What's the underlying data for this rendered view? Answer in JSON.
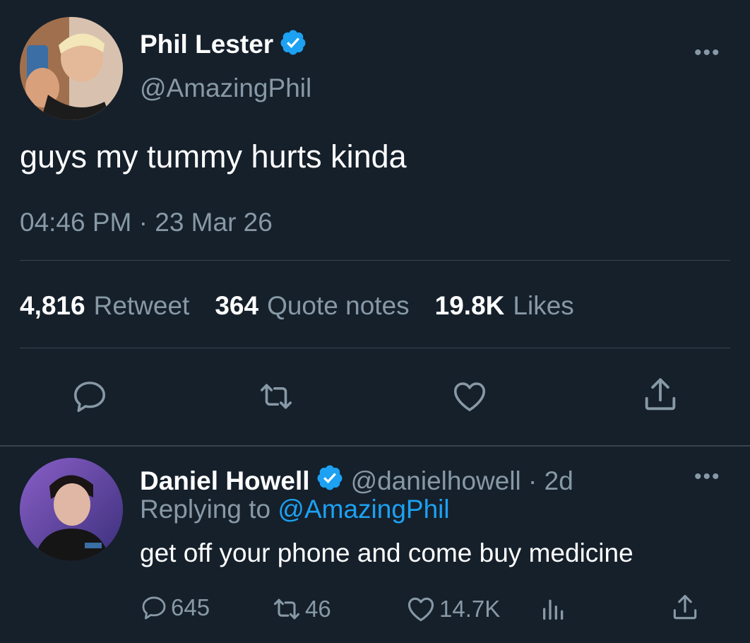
{
  "main_tweet": {
    "author_name": "Phil Lester",
    "handle": "@AmazingPhil",
    "text": "guys my tummy hurts kinda",
    "meta": "04:46 PM · 23 Mar 26",
    "more_glyph": "•••",
    "stats": [
      {
        "value": "4,816",
        "label": "Retweet"
      },
      {
        "value": "364",
        "label": "Quote notes"
      },
      {
        "value": "19.8K",
        "label": "Likes"
      }
    ],
    "actions": [
      "reply-icon",
      "retweet-icon",
      "like-icon",
      "share-icon"
    ]
  },
  "reply": {
    "author_name": "Daniel Howell",
    "handle_time": "@danielhowell · 2d",
    "replying_prefix": "Replying to",
    "replying_target": "@AmazingPhil",
    "text": "get off your phone and come buy medicine",
    "more_glyph": "•••",
    "reply_count": "645",
    "retweet_count": "46",
    "like_count": "14.7K"
  },
  "colors": {
    "background": "#15202b",
    "muted": "#8899a6",
    "accent": "#1da1f2",
    "divider": "#38444d"
  }
}
